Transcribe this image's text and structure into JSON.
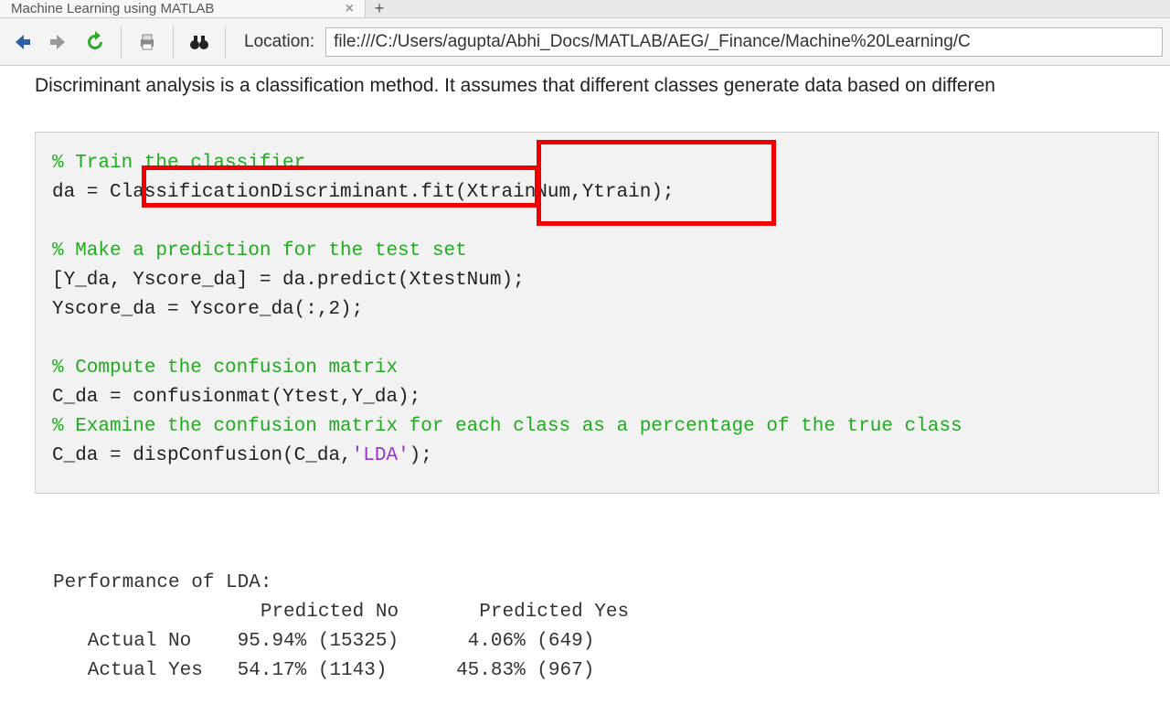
{
  "tab": {
    "title": "Machine Learning using MATLAB",
    "close": "×",
    "add": "+"
  },
  "toolbar": {
    "location_label": "Location:",
    "url": "file:///C:/Users/agupta/Abhi_Docs/MATLAB/AEG/_Finance/Machine%20Learning/C"
  },
  "desc": "Discriminant analysis is a classification method. It assumes that different classes generate data based on differen",
  "code": {
    "c1": "% Train the classifier",
    "l1a": "da = ",
    "l1b": "ClassificationDiscriminant.fit",
    "l1c": "(XtrainNum,Ytrain)",
    "l1d": ";",
    "c2": "% Make a prediction for the test set",
    "l2": "[Y_da, Yscore_da] = da.predict(XtestNum);",
    "l3": "Yscore_da = Yscore_da(:,2);",
    "c3": "% Compute the confusion matrix",
    "l4": "C_da = confusionmat(Ytest,Y_da);",
    "c4": "% Examine the confusion matrix for each class as a percentage of the true class",
    "l5a": "C_da = dispConfusion(C_da,",
    "l5s": "'LDA'",
    "l5b": ");"
  },
  "output": {
    "title": "Performance of LDA:",
    "hdr": "                  Predicted No       Predicted Yes",
    "r1": "   Actual No    95.94% (15325)      4.06% (649)",
    "r2": "   Actual Yes   54.17% (1143)      45.83% (967)"
  },
  "chart_data": {
    "type": "table",
    "title": "Performance of LDA:",
    "columns": [
      "",
      "Predicted No",
      "Predicted Yes"
    ],
    "rows": [
      {
        "label": "Actual No",
        "pred_no_pct": 95.94,
        "pred_no_n": 15325,
        "pred_yes_pct": 4.06,
        "pred_yes_n": 649
      },
      {
        "label": "Actual Yes",
        "pred_no_pct": 54.17,
        "pred_no_n": 1143,
        "pred_yes_pct": 45.83,
        "pred_yes_n": 967
      }
    ]
  }
}
